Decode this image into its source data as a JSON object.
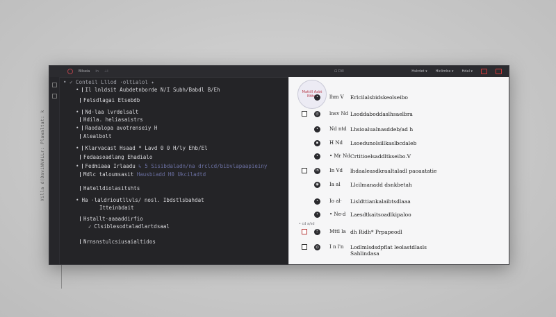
{
  "vertical_caption": "Villa d(DaviNVALLr: Plawaltat: k",
  "titlebar": {
    "title": "Bilseia",
    "items": [
      "in",
      "⊥i"
    ],
    "center_label": "⊡ Dill",
    "right_buttons": [
      "Hxlrdet ▾",
      "Hiclimbe ▾",
      "Hdal ▾"
    ]
  },
  "editor": {
    "header": "• ✓ Conteil Lllod    ·oltialol ✦",
    "lines": [
      {
        "bullet": "•",
        "text": "Il lnldsit Aubdetnborde N/I Subh/Babdl B/Eh"
      },
      {
        "bullet": "",
        "text": "Felsdlagai Etsebdb"
      },
      {
        "bullet": "•",
        "text": "Nd·laa lvrdelsalt"
      },
      {
        "bullet": "",
        "text": "Hdila. heliasaistrs"
      },
      {
        "bullet": "•",
        "text": "Raodalopa avotrenseiy H"
      },
      {
        "bullet": "",
        "text": "Alealbolt"
      },
      {
        "bullet": "•",
        "text": "Klarvacast  Hsaad * Lavd 0 0 H/ly Ehb/El"
      },
      {
        "bullet": "",
        "text": "Fedaasoadlang Ehadialo"
      },
      {
        "bullet": "•",
        "text": "Fedmiaaa Irlaadu",
        "dim": "↳ 5 Sisibdaladn/na drclcd/bibvlapaapieiny"
      },
      {
        "bullet": "",
        "text": "Mdlc taloumsasit",
        "dim": "Hausbiadd H0 Ukciladtd"
      },
      {
        "bullet": "",
        "text": "Hatelldiolasitshts"
      },
      {
        "bullet": "•",
        "text": "Ha ·laldrioutllvls/ nosl. Ibdstlsbahdat"
      },
      {
        "bullet": "",
        "text": "Itteinbdait"
      },
      {
        "bullet": "",
        "text": "Hstallt·aaaaddirfio"
      },
      {
        "bullet": "✓",
        "text": "Clsiblesodtaladlartdsaal"
      },
      {
        "bullet": "",
        "text": "Nrnsnstulcsiusaialtidos"
      }
    ]
  },
  "panel": {
    "badge": "Mattill Aabt Ntitet",
    "section_label": "• cd a/sd",
    "rows": [
      {
        "meta": "lhm V",
        "text": "Erlcilalsbidskeolseibo",
        "check": false,
        "dot": "•"
      },
      {
        "meta": "lnsv Nd",
        "text": "Lsoddaboddaslhsaelbra",
        "check": true,
        "dot": "Ⓔ"
      },
      {
        "meta": "Nd ntd",
        "text": "Lhsioalualnasddeb/ad h",
        "check": false,
        "dot": "•"
      },
      {
        "meta": "H Nd",
        "text": "Lsoedunolsillkaslbcdaleb",
        "check": false,
        "dot": "▪"
      },
      {
        "meta": "• Mr Nd",
        "text": "Crtitioelsaddltkseibo.V",
        "check": false,
        "dot": "•"
      },
      {
        "meta": "In Vd",
        "text": "lhdaaleasdkraaltaladl paoaatatie",
        "check": true,
        "dot": "lh"
      },
      {
        "meta": "Ia al",
        "text": "Llcilmanadd dsnkbetah",
        "check": false,
        "dot": "◉"
      },
      {
        "meta": "Io al·",
        "text": "Lisldttiankalaibtsdlaaa",
        "check": false,
        "dot": "•"
      },
      {
        "meta": "• Ne·d",
        "text": "Laesdtkaitsoadlkipaloo",
        "check": false,
        "dot": "•"
      },
      {
        "meta": "Mttl la",
        "text": "dh Ridh* Prpapeodl",
        "check": true,
        "dot": "Ξ",
        "red": true
      },
      {
        "meta": "I n l'n",
        "text": "Lodlmlsdsdpflat leolastdlasls",
        "check": false,
        "dot": "Ⓞ",
        "text2": "Sahlindasa"
      }
    ]
  }
}
